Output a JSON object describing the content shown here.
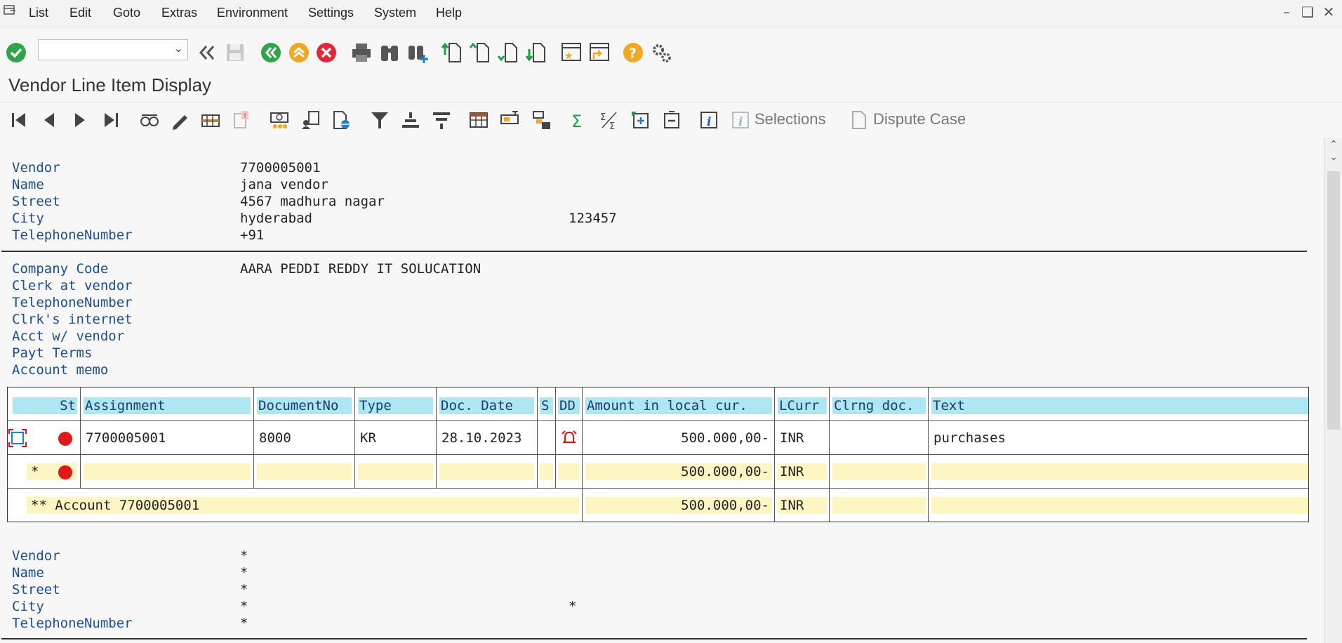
{
  "menu": {
    "items": [
      "List",
      "Edit",
      "Goto",
      "Extras",
      "Environment",
      "Settings",
      "System",
      "Help"
    ]
  },
  "window": {
    "title": "Vendor Line Item Display"
  },
  "toolbar2": {
    "selections_label": "Selections",
    "dispute_label": "Dispute Case"
  },
  "header": {
    "vendor_label": "Vendor",
    "vendor_value": "7700005001",
    "name_label": "Name",
    "name_value": "jana vendor",
    "street_label": "Street",
    "street_value": "4567 madhura nagar",
    "city_label": "City",
    "city_value": "hyderabad",
    "postal_value": "123457",
    "phone_label": "TelephoneNumber",
    "phone_value": "+91"
  },
  "company": {
    "company_code_label": "Company Code",
    "company_code_value": "AARA PEDDI REDDY IT SOLUCATION",
    "clerk_label": "Clerk at vendor",
    "phone_label": "TelephoneNumber",
    "internet_label": "Clrk's internet",
    "acct_label": "Acct w/ vendor",
    "payt_label": "Payt Terms",
    "memo_label": "Account memo"
  },
  "table": {
    "columns": [
      "St",
      "Assignment",
      "DocumentNo",
      "Type",
      "Doc. Date",
      "S",
      "DD",
      "Amount in local cur.",
      "LCurr",
      "Clrng doc.",
      "Text"
    ],
    "row": {
      "assignment": "7700005001",
      "document_no": "8000",
      "type": "KR",
      "doc_date": "28.10.2023",
      "amount": "500.000,00-",
      "currency": "INR",
      "text": "purchases"
    },
    "subtotal": {
      "marker": "*",
      "amount": "500.000,00-",
      "currency": "INR"
    },
    "total": {
      "label": "** Account 7700005001",
      "amount": "500.000,00-",
      "currency": "INR"
    }
  },
  "footer": {
    "vendor_label": "Vendor",
    "vendor_value": "*",
    "name_label": "Name",
    "name_value": "*",
    "street_label": "Street",
    "street_value": "*",
    "city_label": "City",
    "city_value": "*",
    "postal_value": "*",
    "phone_label": "TelephoneNumber",
    "phone_value": "*"
  }
}
